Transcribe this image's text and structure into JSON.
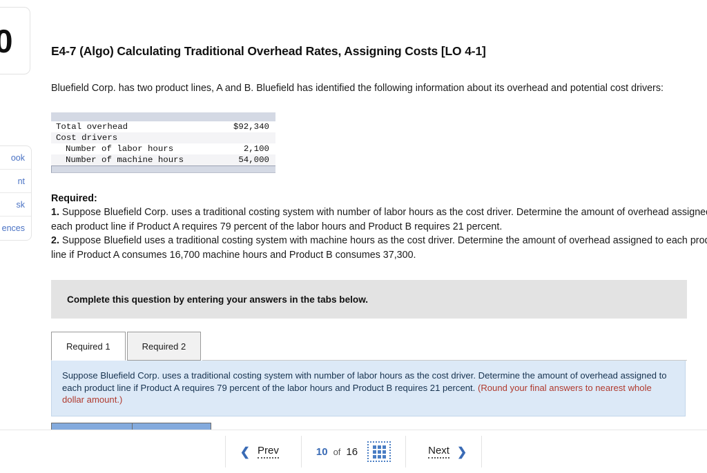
{
  "counter_card": {
    "value": "0"
  },
  "left_tools": {
    "items": [
      {
        "label": "ook"
      },
      {
        "label": "nt"
      },
      {
        "label": "sk"
      },
      {
        "label": "ences"
      }
    ]
  },
  "question": {
    "title": "E4-7 (Algo) Calculating Traditional Overhead Rates, Assigning Costs [LO 4-1]",
    "intro": "Bluefield Corp. has two product lines, A and B. Bluefield has identified the following information about its overhead and potential cost drivers:"
  },
  "data_table": {
    "rows": [
      {
        "label": "Total overhead",
        "indent": false,
        "value": "$92,340",
        "shaded": false
      },
      {
        "label": "Cost drivers",
        "indent": false,
        "value": "",
        "shaded": true
      },
      {
        "label": "Number of labor hours",
        "indent": true,
        "value": "2,100",
        "shaded": false
      },
      {
        "label": "Number of machine hours",
        "indent": true,
        "value": "54,000",
        "shaded": true
      }
    ]
  },
  "required": {
    "heading": "Required:",
    "items": [
      {
        "num": "1.",
        "text": " Suppose Bluefield Corp. uses a traditional costing system with number of labor hours as the cost driver. Determine the amount of overhead assigned to each product line if Product A requires 79 percent of the labor hours and Product B requires 21 percent."
      },
      {
        "num": "2.",
        "text": " Suppose Bluefield uses a traditional costing system with machine hours as the cost driver. Determine the amount of overhead assigned to each product line if Product A consumes 16,700 machine hours and Product B consumes 37,300."
      }
    ]
  },
  "complete_banner": {
    "text": "Complete this question by entering your answers in the tabs below."
  },
  "tabs": [
    {
      "label": "Required 1",
      "active": true
    },
    {
      "label": "Required 2",
      "active": false
    }
  ],
  "instruction_panel": {
    "text": "Suppose Bluefield Corp. uses a traditional costing system with number of labor hours as the cost driver. Determine the amount of overhead assigned to each product line if Product A requires 79 percent of the labor hours and Product B requires 21 percent. ",
    "round_note": "(Round your final answers to nearest whole dollar amount.)"
  },
  "bottom_nav": {
    "prev_label": "Prev",
    "prev_icon": "chevron-left-icon",
    "current_page": "10",
    "of_label": "of",
    "total_pages": "16",
    "grid_icon": "grid-3x3-icon",
    "next_label": "Next",
    "next_icon": "chevron-right-icon"
  },
  "colors": {
    "link_blue": "#4a72c4",
    "accent_blue": "#3a6bb5",
    "panel_blue": "#dce9f7",
    "note_red": "#b03a2e",
    "table_bar": "#d4d9e4",
    "banner_gray": "#e3e3e3"
  }
}
